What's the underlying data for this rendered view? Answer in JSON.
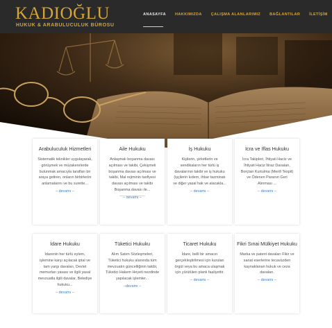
{
  "brand": {
    "title": "KADIOĞLU",
    "subtitle": "HUKUK & ARABULUCULUK BÜROSU"
  },
  "nav": [
    {
      "label": "ANASAYFA",
      "active": true
    },
    {
      "label": "HAKKIMIZDA",
      "active": false
    },
    {
      "label": "ÇALIŞMA ALANLARIMIZ",
      "active": false
    },
    {
      "label": "BAĞLANTILAR",
      "active": false
    },
    {
      "label": "İLETİŞİM",
      "active": false
    }
  ],
  "colors": {
    "header_bg": "#2a2a2a",
    "brand_gold": "#d4a63a",
    "link_blue": "#3a7fc1"
  },
  "cards": [
    {
      "title": "Arabuluculuk Hizmetleri",
      "body": "Sistematik teknikler uygulayarak, görüşmek ve müzakerelerde bulunmak amacıyla tarafları bir araya getiren, onların birbirlerini anlamalarını ve bu surette...",
      "more": "– devamı –"
    },
    {
      "title": "Aile Hukuku",
      "body": "Anlaşmalı boşanma davası açılması ve takibi, Çekişmeli boşanma davası açılması ve takibi, Mal rejiminin tasfiyesi davası açılması ve takibi Boşanma davası ile...",
      "more": "– devamı –"
    },
    {
      "title": "İş Hukuku",
      "body": "Kişilerin, şirketlerin ve sendikaların her türlü iş davalarının takibi ve iş hukuku (işçilerin kıdem, ihbar tazminatı ve diğer yasal hak ve alacakla...",
      "more": "– devamı –"
    },
    {
      "title": "İcra ve İflas Hukuku",
      "body": "İcra Takipleri, İhtiyati Haciz ve İhtiyati Haciz İtiraz Davaları, Borçtan Kurtulma (Menfi Tespit) ve Ödenen Paranın Geri Alınması ...",
      "more": "– devamı –"
    },
    {
      "title": "İdare Hukuku",
      "body": "İdarenin her türlü eylem, işlemine karşı açılacak iptal ve tam yargı davaları, Devlet memurları yasası ve ilgili yasal mevzuatla ilgili davalar, Belediye hukuku...",
      "more": "– devamı –"
    },
    {
      "title": "Tüketici Hukuku",
      "body": "Alım Satım Sözleşmeleri, Tüketici hukuku alanında tüm mevzuatın güncelliğinin takibi, Tüketici Hakem Heyeti nezdinde yapılacak işlemler...",
      "more": "–devamı –"
    },
    {
      "title": "Ticaret Hukuku",
      "body": "İdare, belli bir amacın gerçekleştirilmesi için kurulan örgüt veya bu amaca ulaşmak için yürütülen planlı faaliyettir.",
      "more": "– devamı –"
    },
    {
      "title": "Fikri Sınai Mülkiyet Hukuku",
      "body": "Marka ve patent davaları Fikir ve sanat eserlerine tecavüzden kaynaklanan hukuk ve ceza davaları.",
      "more": "– devamı –"
    }
  ]
}
